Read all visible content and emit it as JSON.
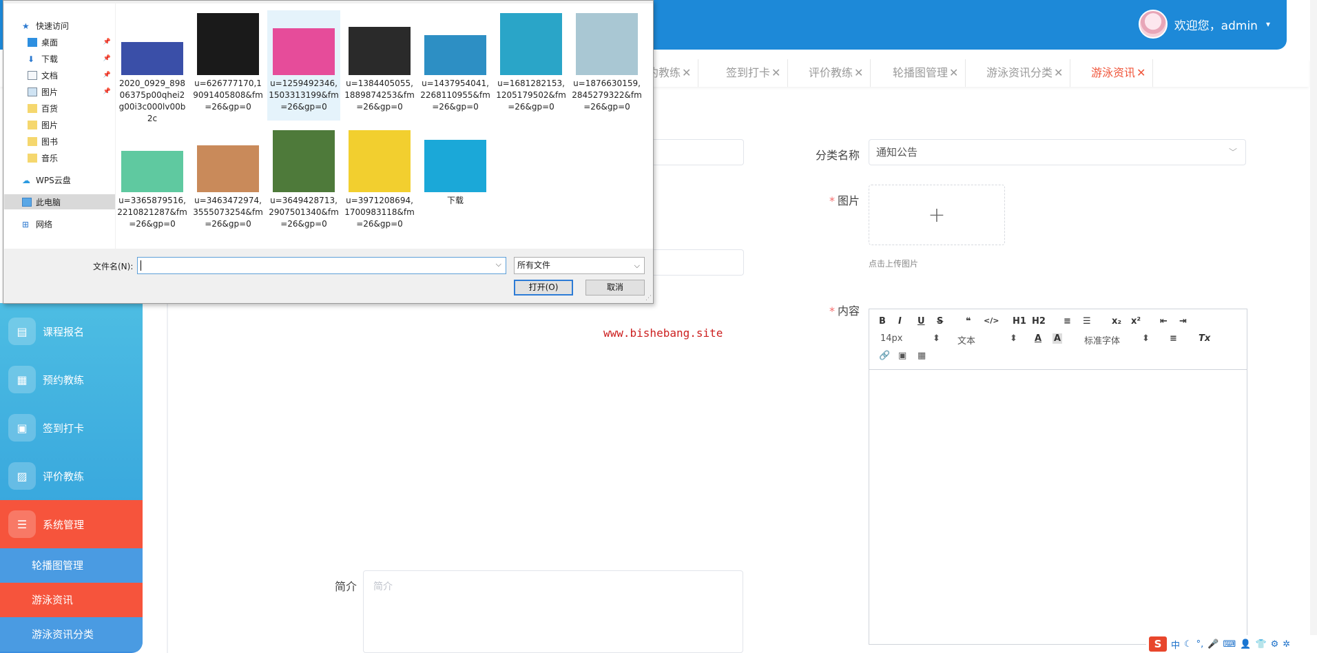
{
  "header": {
    "greeting": "欢迎您，admin",
    "caret": "▾"
  },
  "tabs": [
    {
      "label": "约教练",
      "close": "✕"
    },
    {
      "label": "签到打卡",
      "close": "✕"
    },
    {
      "label": "评价教练",
      "close": "✕"
    },
    {
      "label": "轮播图管理",
      "close": "✕"
    },
    {
      "label": "游泳资讯分类",
      "close": "✕"
    },
    {
      "label": "游泳资讯",
      "close": "✕"
    }
  ],
  "sidebar": {
    "items": [
      {
        "label": "课程报名",
        "icon": "▤"
      },
      {
        "label": "预约教练",
        "icon": "▦"
      },
      {
        "label": "签到打卡",
        "icon": "▣"
      },
      {
        "label": "评价教练",
        "icon": "▨"
      },
      {
        "label": "系统管理",
        "icon": "☰"
      }
    ],
    "subitems": [
      {
        "label": "轮播图管理"
      },
      {
        "label": "游泳资讯"
      },
      {
        "label": "游泳资讯分类"
      }
    ]
  },
  "form": {
    "category_label": "分类名称",
    "category_value": "通知公告",
    "category_chevron": "﹀",
    "image_label": "图片",
    "image_required": "*",
    "upload_plus": "+",
    "upload_tip": "点击上传图片",
    "content_label": "内容",
    "content_required": "*",
    "summary_label": "简介",
    "summary_placeholder": "简介"
  },
  "editor": {
    "row1": [
      "B",
      "I",
      "U",
      "S",
      "❝",
      "</>",
      "H1",
      "H2",
      "≡",
      "☰",
      "x₂",
      "x²",
      "⇤",
      "⇥"
    ],
    "font_size": "14px",
    "font_size_arrow": "⬍",
    "text_type": "文本",
    "text_type_arrow": "⬍",
    "color_a": "A",
    "bg_a": "A",
    "font_family": "标准字体",
    "font_family_arrow": "⬍",
    "align": "≡",
    "clear": "Tx",
    "row3": [
      "🔗",
      "▣",
      "▦"
    ]
  },
  "watermark": "www.bishebang.site",
  "dialog": {
    "nav": [
      {
        "label": "快速访问",
        "icon": "star-icon",
        "pin": ""
      },
      {
        "label": "桌面",
        "icon": "desktop-icon",
        "pin": "📌"
      },
      {
        "label": "下载",
        "icon": "download-icon",
        "pin": "📌"
      },
      {
        "label": "文档",
        "icon": "document-icon",
        "pin": "📌"
      },
      {
        "label": "图片",
        "icon": "pictures-icon",
        "pin": "📌"
      },
      {
        "label": "百货",
        "icon": "folder-icon",
        "pin": ""
      },
      {
        "label": "图片",
        "icon": "folder-icon",
        "pin": ""
      },
      {
        "label": "图书",
        "icon": "folder-icon",
        "pin": ""
      },
      {
        "label": "音乐",
        "icon": "folder-icon",
        "pin": ""
      },
      {
        "label": "WPS云盘",
        "icon": "cloud-icon",
        "pin": ""
      },
      {
        "label": "此电脑",
        "icon": "computer-icon",
        "pin": ""
      },
      {
        "label": "网络",
        "icon": "network-icon",
        "pin": ""
      }
    ],
    "files": [
      {
        "name": "2020_0929_89806375p00qhei2g00i3c000lv00b2c",
        "color": "#3a4fa8"
      },
      {
        "name": "u=626777170,19091405808&fm=26&gp=0",
        "color": "#1a1a1a"
      },
      {
        "name": "u=1259492346,1503313199&fm=26&gp=0",
        "color": "#e64c9a"
      },
      {
        "name": "u=1384405055,1889874253&fm=26&gp=0",
        "color": "#2a2a2a"
      },
      {
        "name": "u=1437954041,2268110955&fm=26&gp=0",
        "color": "#2d8fc4"
      },
      {
        "name": "u=1681282153,1205179502&fm=26&gp=0",
        "color": "#2aa5c8"
      },
      {
        "name": "u=1876630159,2845279322&fm=26&gp=0",
        "color": "#a9c7d3"
      },
      {
        "name": "u=3365879516,2210821287&fm=26&gp=0",
        "color": "#5fc9a0"
      },
      {
        "name": "u=3463472974,3555073254&fm=26&gp=0",
        "color": "#c98a5a"
      },
      {
        "name": "u=3649428713,2907501340&fm=26&gp=0",
        "color": "#4e7a3a"
      },
      {
        "name": "u=3971208694,1700983118&fm=26&gp=0",
        "color": "#f2cf2f"
      },
      {
        "name": "下载",
        "color": "#1ba8d8"
      }
    ],
    "filename_label": "文件名(N):",
    "filename_value": "",
    "filetype": "所有文件",
    "dropdown": "⌵",
    "open_button": "打开(O)",
    "cancel_button": "取消"
  },
  "tray": {
    "ime": "S",
    "lang": "中",
    "icons": [
      "☾",
      "°,",
      "🎤",
      "⌨",
      "👤",
      "👕",
      "⚙",
      "✲"
    ]
  }
}
